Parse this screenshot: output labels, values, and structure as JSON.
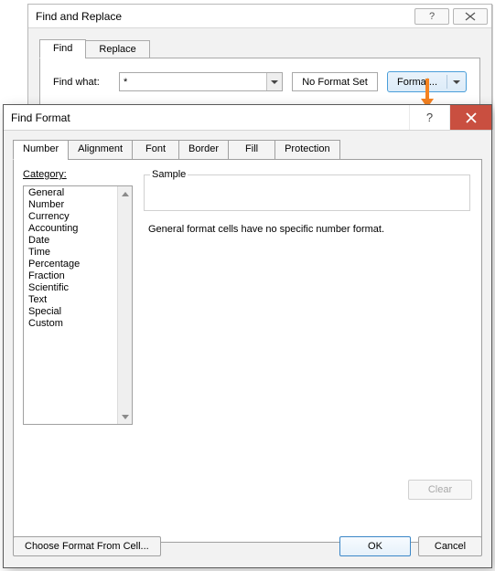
{
  "find_replace": {
    "title": "Find and Replace",
    "tabs": {
      "find": "Find",
      "replace": "Replace"
    },
    "find_what_label": "Find what:",
    "find_what_value": "*",
    "format_state": "No Format Set",
    "format_btn": "Format..."
  },
  "find_format": {
    "title": "Find Format",
    "tabs": {
      "number": "Number",
      "alignment": "Alignment",
      "font": "Font",
      "border": "Border",
      "fill": "Fill",
      "protection": "Protection"
    },
    "category_label": "Category:",
    "categories": [
      "General",
      "Number",
      "Currency",
      "Accounting",
      "Date",
      "Time",
      "Percentage",
      "Fraction",
      "Scientific",
      "Text",
      "Special",
      "Custom"
    ],
    "sample_label": "Sample",
    "description": "General format cells have no specific number format.",
    "clear_btn": "Clear",
    "choose_btn": "Choose Format From Cell...",
    "ok_btn": "OK",
    "cancel_btn": "Cancel"
  }
}
